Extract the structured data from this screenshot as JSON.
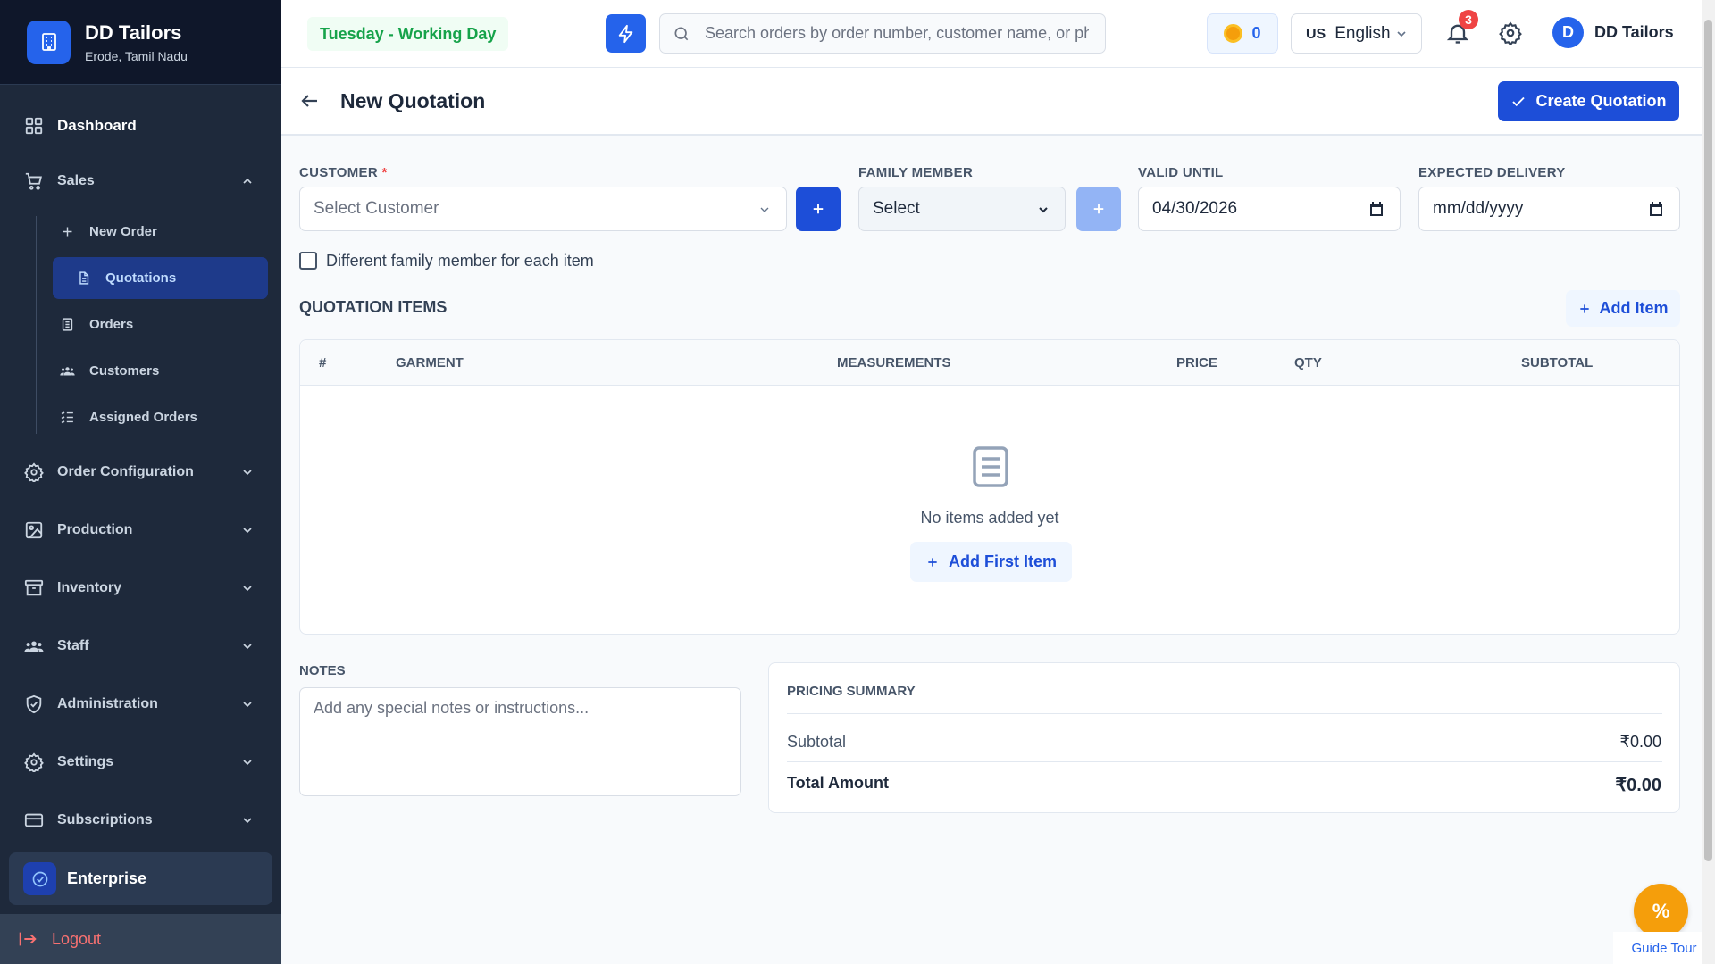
{
  "brand": {
    "name": "DD Tailors",
    "location": "Erode, Tamil Nadu"
  },
  "sidebar": {
    "dashboard": "Dashboard",
    "sales": "Sales",
    "sales_items": [
      {
        "label": "New Order",
        "icon": "plus-icon"
      },
      {
        "label": "Quotations",
        "icon": "document-icon",
        "active": true
      },
      {
        "label": "Orders",
        "icon": "list-icon"
      },
      {
        "label": "Customers",
        "icon": "users-icon"
      },
      {
        "label": "Assigned Orders",
        "icon": "checklist-icon"
      }
    ],
    "sections": [
      "Order Configuration",
      "Production",
      "Inventory",
      "Staff",
      "Administration",
      "Settings",
      "Subscriptions"
    ],
    "plan": "Enterprise",
    "logout": "Logout"
  },
  "header": {
    "day_status": "Tuesday - Working Day",
    "search_placeholder": "Search orders by order number, customer name, or phone",
    "coins": "0",
    "lang_code": "US",
    "language": "English",
    "notifications": "3",
    "avatar_letter": "D",
    "user": "DD Tailors"
  },
  "page": {
    "title": "New Quotation",
    "create_label": "Create Quotation"
  },
  "form": {
    "customer_label": "CUSTOMER",
    "required_mark": "*",
    "customer_placeholder": "Select Customer",
    "family_label": "FAMILY MEMBER",
    "family_value": "Select",
    "valid_label": "VALID UNTIL",
    "valid_value": "04/30/2026",
    "delivery_label": "EXPECTED DELIVERY",
    "delivery_placeholder": "mm/dd/yyyy",
    "checkbox_label": "Different family member for each item",
    "checkbox_checked": false
  },
  "items": {
    "title": "QUOTATION ITEMS",
    "add_label": "Add Item",
    "columns": [
      "#",
      "GARMENT",
      "MEASUREMENTS",
      "PRICE",
      "QTY",
      "SUBTOTAL"
    ],
    "empty_text": "No items added yet",
    "add_first_label": "Add First Item"
  },
  "notes": {
    "label": "NOTES",
    "placeholder": "Add any special notes or instructions..."
  },
  "summary": {
    "title": "PRICING SUMMARY",
    "subtotal_label": "Subtotal",
    "subtotal_value": "₹0.00",
    "total_label": "Total Amount",
    "total_value": "₹0.00"
  },
  "tour": {
    "icon_text": "%",
    "label": "Guide Tour"
  },
  "colors": {
    "primary": "#1d4ed8",
    "sidebar": "#1e293b",
    "active": "#1e3a8a",
    "success": "#16a34a",
    "danger": "#ef4444",
    "accent": "#f59e0b"
  }
}
